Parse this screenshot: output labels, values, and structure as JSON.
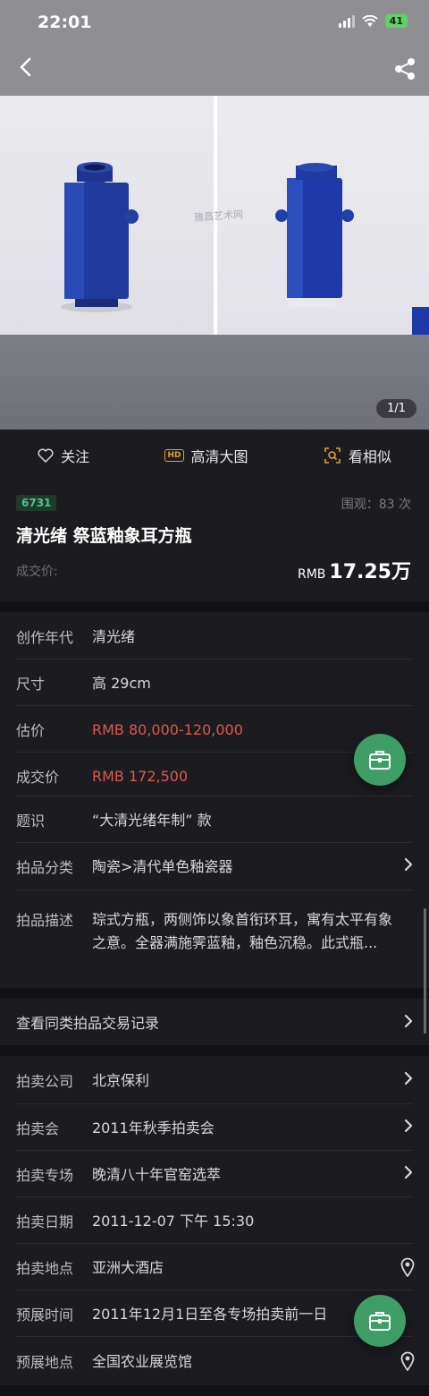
{
  "status": {
    "time": "22:01",
    "battery": "41"
  },
  "hero": {
    "page_counter": "1/1",
    "watermark": "雅昌艺术网"
  },
  "actions": {
    "follow": "关注",
    "hd_image": "高清大图",
    "similar": "看相似",
    "hd_badge": "HD"
  },
  "lot": {
    "number": "6731",
    "views": "围观：83 次",
    "title": "清光绪 祭蓝釉象耳方瓶",
    "sold_label": "成交价:",
    "price_currency": "RMB",
    "price_amount": "17.25万"
  },
  "details": [
    {
      "key": "创作年代",
      "value": "清光绪"
    },
    {
      "key": "尺寸",
      "value": "高 29cm"
    },
    {
      "key": "估价",
      "value": "RMB  80,000-120,000"
    },
    {
      "key": "成交价",
      "value": "RMB 172,500"
    },
    {
      "key": "题识",
      "value": "“大清光绪年制” 款"
    },
    {
      "key": "拍品分类",
      "value": "陶瓷>清代单色釉瓷器"
    },
    {
      "key": "拍品描述",
      "value": "琮式方瓶，两侧饰以象首衔环耳，寓有太平有象之意。全器满施霁蓝釉，釉色沉稳。此式瓶..."
    }
  ],
  "records_link": "查看同类拍品交易记录",
  "auction": [
    {
      "key": "拍卖公司",
      "value": "北京保利"
    },
    {
      "key": "拍卖会",
      "value": "2011年秋季拍卖会"
    },
    {
      "key": "拍卖专场",
      "value": "晚清八十年官窑选萃"
    },
    {
      "key": "拍卖日期",
      "value": "2011-12-07 下午 15:30"
    },
    {
      "key": "拍卖地点",
      "value": "亚洲大酒店"
    },
    {
      "key": "预展时间",
      "value": "2011年12月1日至各专场拍卖前一日"
    },
    {
      "key": "预展地点",
      "value": "全国农业展览馆"
    }
  ],
  "colors": {
    "accent_green": "#3f9e66",
    "price_red": "#e0564d",
    "background": "#1c1c20"
  }
}
